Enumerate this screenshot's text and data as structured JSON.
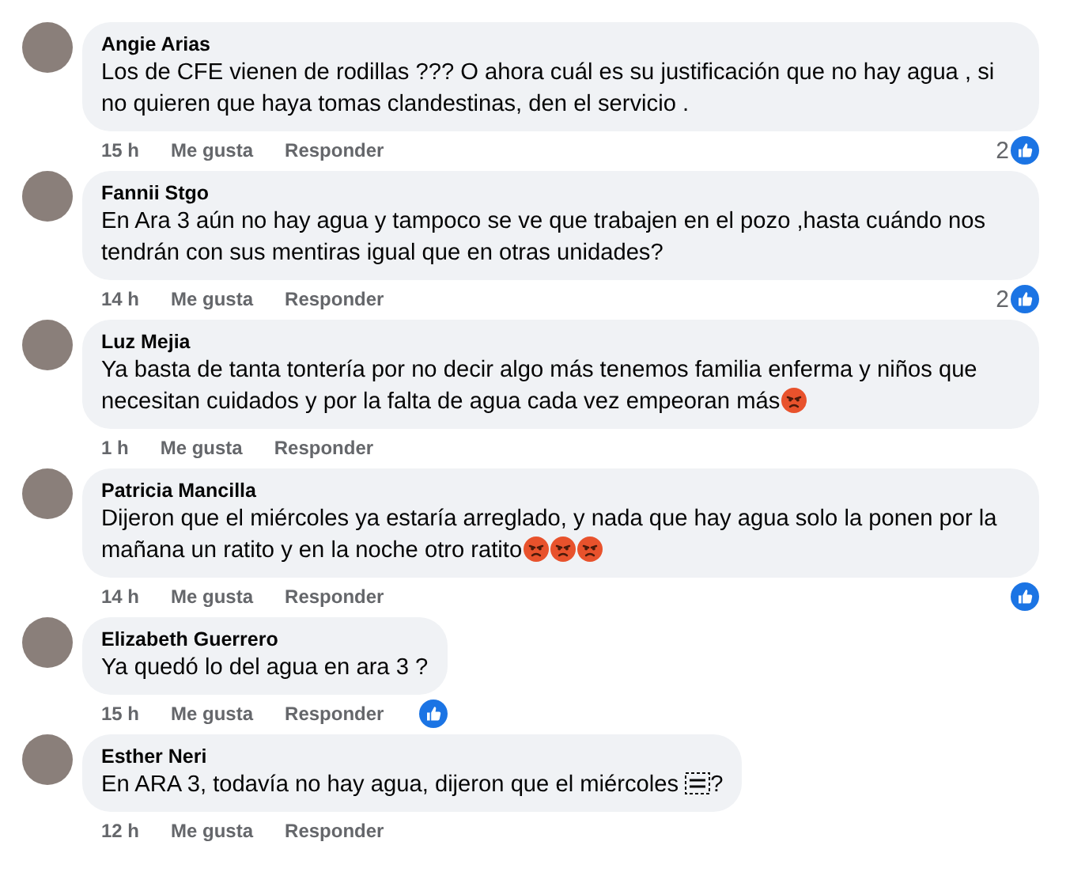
{
  "comments": [
    {
      "author": "Angie Arias",
      "content": [
        {
          "kind": "text",
          "text": "Los de CFE vienen de rodillas ??? O ahora cuál es su justificación que no hay agua , si no quieren que haya tomas clandestinas, den el servicio ."
        }
      ],
      "time": "15 h",
      "like_label": "Me gusta",
      "reply_label": "Responder",
      "liked": true,
      "like_count": "2"
    },
    {
      "author": "Fannii Stgo",
      "content": [
        {
          "kind": "text",
          "text": "En Ara 3 aún no hay agua y tampoco se ve que trabajen en el pozo ,hasta cuándo nos tendrán con sus mentiras igual que en otras unidades?"
        }
      ],
      "time": "14 h",
      "like_label": "Me gusta",
      "reply_label": "Responder",
      "liked": true,
      "like_count": "2"
    },
    {
      "author": "Luz Mejia",
      "content": [
        {
          "kind": "text",
          "text": "Ya basta de tanta tontería por no decir algo más tenemos familia enferma y niños que necesitan cuidados y por la falta de agua cada vez empeoran más"
        },
        {
          "kind": "angry_emoji"
        }
      ],
      "time": "1 h",
      "like_label": "Me gusta",
      "reply_label": "Responder",
      "liked": false
    },
    {
      "author": "Patricia Mancilla",
      "content": [
        {
          "kind": "text",
          "text": "Dijeron que el miércoles ya estaría arreglado, y nada que hay agua solo la ponen por la mañana un ratito y en la noche otro ratito"
        },
        {
          "kind": "angry_emoji"
        },
        {
          "kind": "angry_emoji"
        },
        {
          "kind": "angry_emoji"
        }
      ],
      "time": "14 h",
      "like_label": "Me gusta",
      "reply_label": "Responder",
      "liked": true
    },
    {
      "author": "Elizabeth Guerrero",
      "content": [
        {
          "kind": "text",
          "text": "Ya quedó lo del agua en ara 3 ?"
        }
      ],
      "time": "15 h",
      "like_label": "Me gusta",
      "reply_label": "Responder",
      "liked": true
    },
    {
      "author": "Esther Neri",
      "content": [
        {
          "kind": "text",
          "text": "En ARA 3, todavía no hay agua, dijeron que el miércoles "
        },
        {
          "kind": "object_placeholder"
        },
        {
          "kind": "text",
          "text": "?"
        }
      ],
      "time": "12 h",
      "like_label": "Me gusta",
      "reply_label": "Responder",
      "liked": false
    }
  ]
}
